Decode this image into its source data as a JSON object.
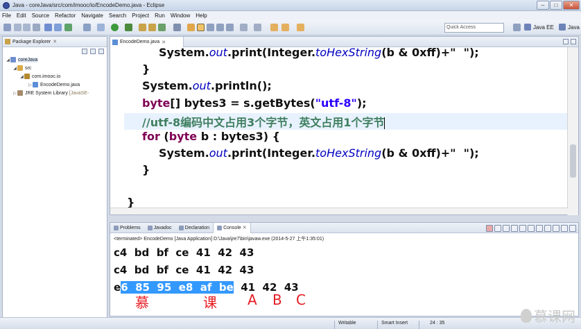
{
  "window": {
    "title": "Java - coreJava/src/com/imooc/io/EncodeDemo.java - Eclipse"
  },
  "menu": [
    "File",
    "Edit",
    "Source",
    "Refactor",
    "Navigate",
    "Search",
    "Project",
    "Run",
    "Window",
    "Help"
  ],
  "toolbar": {
    "quick_access_placeholder": "Quick Access",
    "perspective_java_ee": "Java EE",
    "perspective_java": "Java"
  },
  "package_explorer": {
    "tab_label": "Package Explorer",
    "tree": [
      {
        "label": "coreJava",
        "icon": "project-icon"
      },
      {
        "label": "src",
        "icon": "source-folder-icon"
      },
      {
        "label": "com.imooc.io",
        "icon": "package-icon"
      },
      {
        "label": "EncodeDemo.java",
        "icon": "java-file-icon"
      },
      {
        "label": "JRE System Library",
        "suffix": "[JavaSE-",
        "icon": "library-icon"
      }
    ]
  },
  "editor": {
    "tab_label": "EncodeDemo.java",
    "lines": {
      "l1_a": "System.",
      "l1_b": "out",
      "l1_c": ".print(Integer.",
      "l1_d": "toHexString",
      "l1_e": "(b & 0xff)+\"  \");",
      "l2": "}",
      "l3_a": "System.",
      "l3_b": "out",
      "l3_c": ".println();",
      "l4_kw": "byte",
      "l4_a": "[] bytes3 = s.getBytes(",
      "l4_str": "\"utf-8\"",
      "l4_b": ");",
      "l5_comment": "//utf-8编码中文占用3个字节，英文占用1个字节",
      "l6_kw1": "for",
      "l6_a": " (",
      "l6_kw2": "byte",
      "l6_b": " b : bytes3) {",
      "l7_a": "System.",
      "l7_b": "out",
      "l7_c": ".print(Integer.",
      "l7_d": "toHexString",
      "l7_e": "(b & 0xff)+\"  \");",
      "l8": "}",
      "l9": "}"
    }
  },
  "console": {
    "tabs": [
      "Problems",
      "Javadoc",
      "Declaration",
      "Console"
    ],
    "terminated": "<terminated> EncodeDemo [Java Application] D:\\Java\\jre7\\bin\\javaw.exe (2014-5-27 上午1:35:01)",
    "out1": "c4  bd  bf  ce  41  42  43",
    "out2": "c4  bd  bf  ce  41  42  43",
    "out3_pre": "e",
    "out3_sel": "6  85  95  e8  af  be",
    "out3_post": "  41  42  43",
    "annotations": [
      "慕",
      "课",
      "A",
      "B",
      "C"
    ]
  },
  "status": {
    "writable": "Writable",
    "insert": "Smart Insert",
    "position": "24 : 35"
  },
  "watermark": "慕课网",
  "colors": {
    "keyword": "#7f0055",
    "string": "#2a00ff",
    "comment": "#3f7f5f",
    "selection": "#3399ff",
    "annotation": "#e51c23"
  }
}
